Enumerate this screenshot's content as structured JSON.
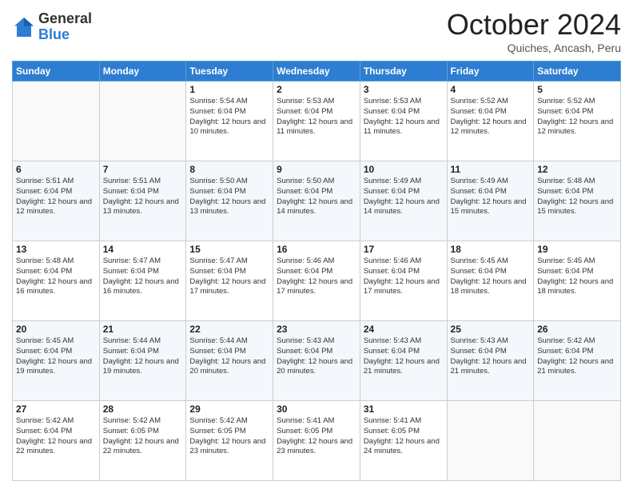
{
  "logo": {
    "general": "General",
    "blue": "Blue"
  },
  "header": {
    "month": "October 2024",
    "location": "Quiches, Ancash, Peru"
  },
  "weekdays": [
    "Sunday",
    "Monday",
    "Tuesday",
    "Wednesday",
    "Thursday",
    "Friday",
    "Saturday"
  ],
  "weeks": [
    [
      {
        "day": "",
        "info": ""
      },
      {
        "day": "",
        "info": ""
      },
      {
        "day": "1",
        "info": "Sunrise: 5:54 AM\nSunset: 6:04 PM\nDaylight: 12 hours and 10 minutes."
      },
      {
        "day": "2",
        "info": "Sunrise: 5:53 AM\nSunset: 6:04 PM\nDaylight: 12 hours and 11 minutes."
      },
      {
        "day": "3",
        "info": "Sunrise: 5:53 AM\nSunset: 6:04 PM\nDaylight: 12 hours and 11 minutes."
      },
      {
        "day": "4",
        "info": "Sunrise: 5:52 AM\nSunset: 6:04 PM\nDaylight: 12 hours and 12 minutes."
      },
      {
        "day": "5",
        "info": "Sunrise: 5:52 AM\nSunset: 6:04 PM\nDaylight: 12 hours and 12 minutes."
      }
    ],
    [
      {
        "day": "6",
        "info": "Sunrise: 5:51 AM\nSunset: 6:04 PM\nDaylight: 12 hours and 12 minutes."
      },
      {
        "day": "7",
        "info": "Sunrise: 5:51 AM\nSunset: 6:04 PM\nDaylight: 12 hours and 13 minutes."
      },
      {
        "day": "8",
        "info": "Sunrise: 5:50 AM\nSunset: 6:04 PM\nDaylight: 12 hours and 13 minutes."
      },
      {
        "day": "9",
        "info": "Sunrise: 5:50 AM\nSunset: 6:04 PM\nDaylight: 12 hours and 14 minutes."
      },
      {
        "day": "10",
        "info": "Sunrise: 5:49 AM\nSunset: 6:04 PM\nDaylight: 12 hours and 14 minutes."
      },
      {
        "day": "11",
        "info": "Sunrise: 5:49 AM\nSunset: 6:04 PM\nDaylight: 12 hours and 15 minutes."
      },
      {
        "day": "12",
        "info": "Sunrise: 5:48 AM\nSunset: 6:04 PM\nDaylight: 12 hours and 15 minutes."
      }
    ],
    [
      {
        "day": "13",
        "info": "Sunrise: 5:48 AM\nSunset: 6:04 PM\nDaylight: 12 hours and 16 minutes."
      },
      {
        "day": "14",
        "info": "Sunrise: 5:47 AM\nSunset: 6:04 PM\nDaylight: 12 hours and 16 minutes."
      },
      {
        "day": "15",
        "info": "Sunrise: 5:47 AM\nSunset: 6:04 PM\nDaylight: 12 hours and 17 minutes."
      },
      {
        "day": "16",
        "info": "Sunrise: 5:46 AM\nSunset: 6:04 PM\nDaylight: 12 hours and 17 minutes."
      },
      {
        "day": "17",
        "info": "Sunrise: 5:46 AM\nSunset: 6:04 PM\nDaylight: 12 hours and 17 minutes."
      },
      {
        "day": "18",
        "info": "Sunrise: 5:45 AM\nSunset: 6:04 PM\nDaylight: 12 hours and 18 minutes."
      },
      {
        "day": "19",
        "info": "Sunrise: 5:45 AM\nSunset: 6:04 PM\nDaylight: 12 hours and 18 minutes."
      }
    ],
    [
      {
        "day": "20",
        "info": "Sunrise: 5:45 AM\nSunset: 6:04 PM\nDaylight: 12 hours and 19 minutes."
      },
      {
        "day": "21",
        "info": "Sunrise: 5:44 AM\nSunset: 6:04 PM\nDaylight: 12 hours and 19 minutes."
      },
      {
        "day": "22",
        "info": "Sunrise: 5:44 AM\nSunset: 6:04 PM\nDaylight: 12 hours and 20 minutes."
      },
      {
        "day": "23",
        "info": "Sunrise: 5:43 AM\nSunset: 6:04 PM\nDaylight: 12 hours and 20 minutes."
      },
      {
        "day": "24",
        "info": "Sunrise: 5:43 AM\nSunset: 6:04 PM\nDaylight: 12 hours and 21 minutes."
      },
      {
        "day": "25",
        "info": "Sunrise: 5:43 AM\nSunset: 6:04 PM\nDaylight: 12 hours and 21 minutes."
      },
      {
        "day": "26",
        "info": "Sunrise: 5:42 AM\nSunset: 6:04 PM\nDaylight: 12 hours and 21 minutes."
      }
    ],
    [
      {
        "day": "27",
        "info": "Sunrise: 5:42 AM\nSunset: 6:04 PM\nDaylight: 12 hours and 22 minutes."
      },
      {
        "day": "28",
        "info": "Sunrise: 5:42 AM\nSunset: 6:05 PM\nDaylight: 12 hours and 22 minutes."
      },
      {
        "day": "29",
        "info": "Sunrise: 5:42 AM\nSunset: 6:05 PM\nDaylight: 12 hours and 23 minutes."
      },
      {
        "day": "30",
        "info": "Sunrise: 5:41 AM\nSunset: 6:05 PM\nDaylight: 12 hours and 23 minutes."
      },
      {
        "day": "31",
        "info": "Sunrise: 5:41 AM\nSunset: 6:05 PM\nDaylight: 12 hours and 24 minutes."
      },
      {
        "day": "",
        "info": ""
      },
      {
        "day": "",
        "info": ""
      }
    ]
  ]
}
